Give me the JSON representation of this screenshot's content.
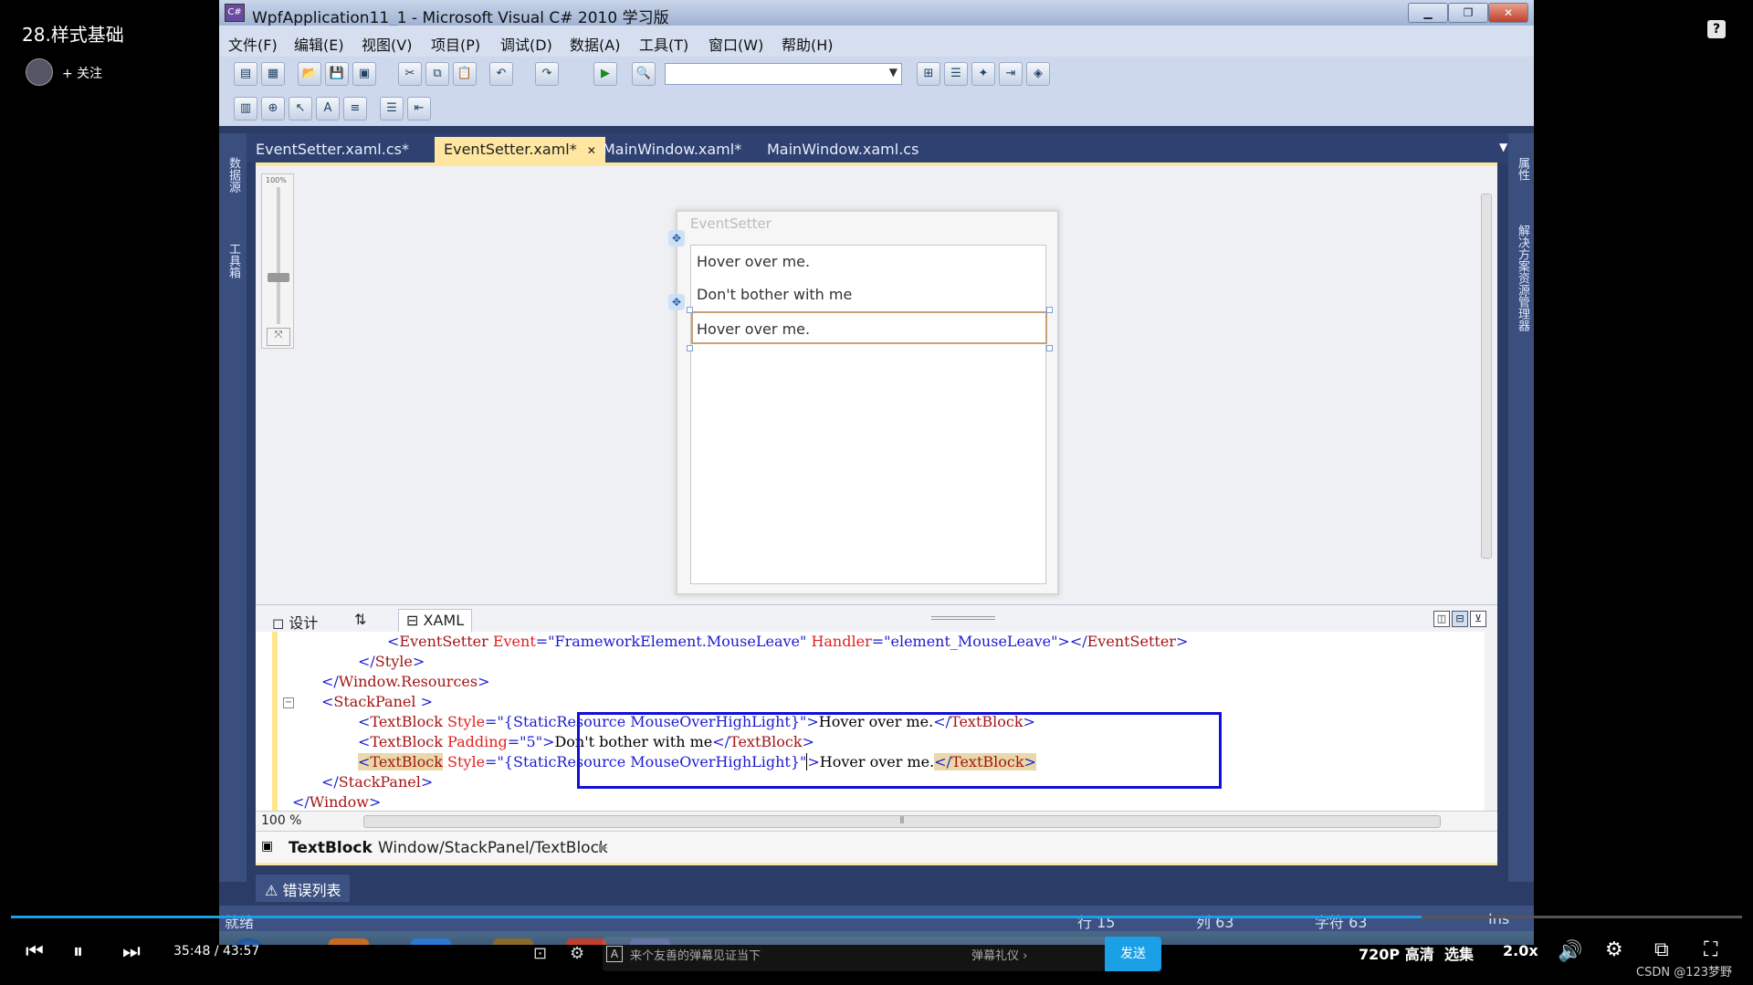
{
  "player": {
    "video_title": "28.样式基础",
    "follow_label": "+ 关注",
    "help_icon": "?",
    "current_time": "35:48",
    "separator": "/",
    "duration": "43:57",
    "progress_fraction": 0.815,
    "danmaku_placeholder": "来个友善的弹幕见证当下",
    "danmaku_etiquette": "弹幕礼仪 ›",
    "send_label": "发送",
    "quality_label": "720P 高清",
    "episodes_label": "选集",
    "speed_label": "2.0x",
    "watermark": "CSDN @123梦野",
    "accent_color": "#1aa0e6"
  },
  "vs": {
    "window_title": "WpfApplication11_1 - Microsoft Visual C# 2010 学习版",
    "menu": [
      "文件(F)",
      "编辑(E)",
      "视图(V)",
      "项目(P)",
      "调试(D)",
      "数据(A)",
      "工具(T)",
      "窗口(W)",
      "帮助(H)"
    ],
    "left_panels": [
      "数据源",
      "工具箱"
    ],
    "right_panels": [
      "属性",
      "解决方案资源管理器"
    ],
    "tabs": [
      "EventSetter.xaml.cs*",
      "EventSetter.xaml*",
      "MainWindow.xaml*",
      "MainWindow.xaml.cs"
    ],
    "active_tab_close": "✕",
    "designer": {
      "zoom_label": "100%",
      "window_title": "EventSetter",
      "items": [
        "Hover over me.",
        "Don't bother with me",
        "Hover over me."
      ]
    },
    "split_tabs": {
      "design": "设计",
      "swap": "⇅",
      "xaml": "XAML"
    },
    "xaml_zoom": "100 %",
    "path": {
      "element": "TextBlock",
      "path": "Window/StackPanel/TextBlock"
    },
    "error_list_label": "错误列表",
    "status": {
      "ready": "就绪",
      "line": "行 15",
      "col": "列 63",
      "char": "字符 63",
      "ins": "Ins"
    }
  }
}
